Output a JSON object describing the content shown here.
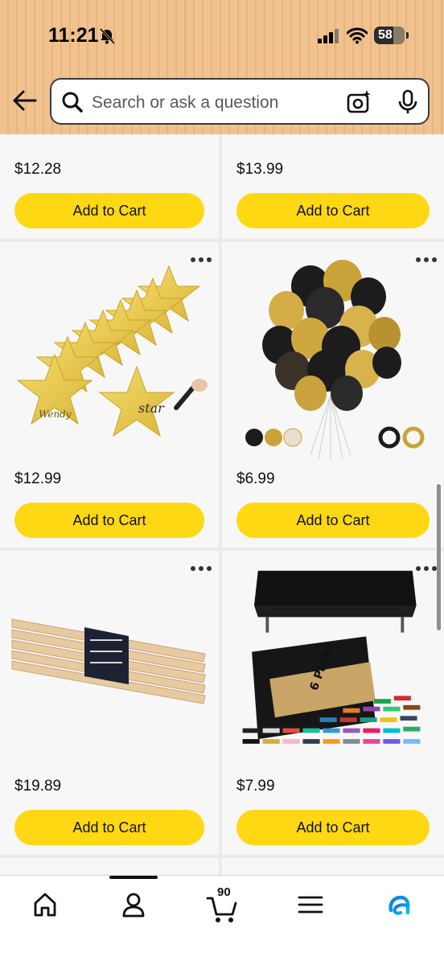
{
  "status": {
    "time": "11:21",
    "battery": "58"
  },
  "search": {
    "placeholder": "Search or ask a question"
  },
  "products": [
    {
      "price": "$12.28",
      "button": "Add to Cart"
    },
    {
      "price": "$13.99",
      "button": "Add to Cart"
    },
    {
      "price": "$12.99",
      "button": "Add to Cart",
      "image": "gold-star-cutouts"
    },
    {
      "price": "$6.99",
      "button": "Add to Cart",
      "image": "black-gold-balloons"
    },
    {
      "price": "$19.89",
      "button": "Add to Cart",
      "image": "wooden-drumsticks"
    },
    {
      "price": "$7.99",
      "button": "Add to Cart",
      "image": "black-tablecloths-6-packs",
      "badge": "6 Packs"
    }
  ],
  "nav": {
    "cart_count": "90"
  },
  "colors": {
    "header": "#f0c28f",
    "button": "#ffd814",
    "accent_blue": "#1a73e8"
  }
}
